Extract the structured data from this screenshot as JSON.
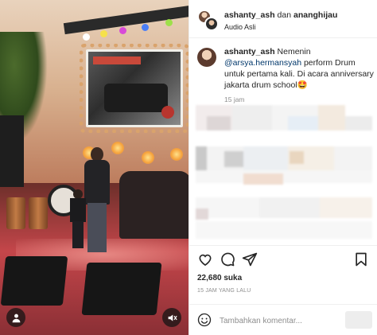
{
  "header": {
    "user1": "ashanty_ash",
    "joiner": "dan",
    "user2": "ananghijau",
    "audio": "Audio Asli"
  },
  "caption": {
    "username": "ashanty_ash",
    "text_before": " Nemenin ",
    "mention": "@arsya.hermansyah",
    "text_after": " perform Drum untuk pertama kali. Di acara anniversary jakarta drum school",
    "emoji": "🤩",
    "time": "15 jam"
  },
  "stats": {
    "likes": "22,680 suka",
    "time_ago": "15 JAM YANG LALU"
  },
  "comment": {
    "placeholder": "Tambahkan komentar..."
  },
  "icons": {
    "user": "user-icon",
    "mute": "mute-icon",
    "like": "heart-icon",
    "comment": "comment-icon",
    "share": "send-icon",
    "save": "bookmark-icon",
    "emoji": "smiley-icon"
  },
  "colors": {
    "text": "#262626",
    "muted": "#8e8e8e",
    "mention": "#00376b",
    "divider": "#efefef"
  }
}
